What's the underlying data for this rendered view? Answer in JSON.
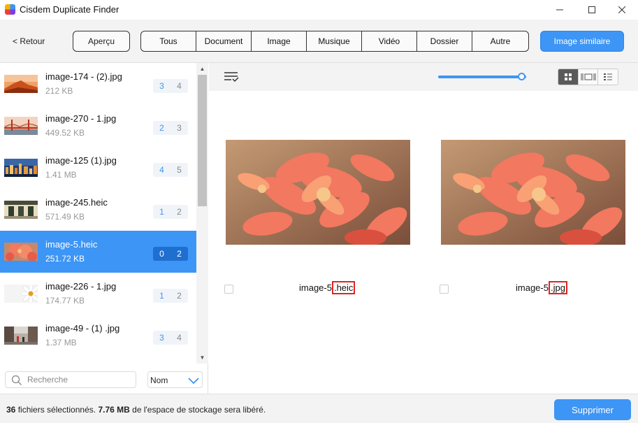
{
  "window": {
    "title": "Cisdem Duplicate Finder",
    "controls": {
      "minimize": "—",
      "maximize": "☐",
      "close": "✕"
    }
  },
  "toolbar": {
    "back_label": "< Retour",
    "preview_label": "Aperçu",
    "tabs": [
      "Tous",
      "Document",
      "Image",
      "Musique",
      "Vidéo",
      "Dossier",
      "Autre"
    ],
    "similar_label": "Image similaire"
  },
  "file_list": {
    "items": [
      {
        "name": "image-174 - (2).jpg",
        "size": "212 KB",
        "count_a": "3",
        "count_b": "4",
        "thumb": "desert"
      },
      {
        "name": "image-270 - 1.jpg",
        "size": "449.52 KB",
        "count_a": "2",
        "count_b": "3",
        "thumb": "bridge"
      },
      {
        "name": "image-125 (1).jpg",
        "size": "1.41 MB",
        "count_a": "4",
        "count_b": "5",
        "thumb": "city-night"
      },
      {
        "name": "image-245.heic",
        "size": "571.49 KB",
        "count_a": "1",
        "count_b": "2",
        "thumb": "house"
      },
      {
        "name": "image-5.heic",
        "size": "251.72 KB",
        "count_a": "0",
        "count_b": "2",
        "thumb": "flower",
        "selected": true
      },
      {
        "name": "image-226 - 1.jpg",
        "size": "174.77 KB",
        "count_a": "1",
        "count_b": "2",
        "thumb": "daisy"
      },
      {
        "name": "image-49 - (1)  .jpg",
        "size": "1.37 MB",
        "count_a": "3",
        "count_b": "4",
        "thumb": "street"
      }
    ]
  },
  "search": {
    "placeholder": "Recherche",
    "value": ""
  },
  "sort": {
    "selected": "Nom"
  },
  "viewer": {
    "zoom_level": 0.95,
    "view_mode": "grid",
    "left": {
      "prefix": "image-5",
      "ext": ".heic"
    },
    "right": {
      "prefix": "image-5",
      "ext": ".jpg"
    }
  },
  "footer": {
    "count": "36",
    "text1": "fichiers sélectionnés.",
    "size": "7.76 MB",
    "text2": "de l'espace de stockage sera libéré.",
    "delete_label": "Supprimer"
  },
  "colors": {
    "accent": "#3d95f5",
    "highlight_box": "#e62222"
  }
}
